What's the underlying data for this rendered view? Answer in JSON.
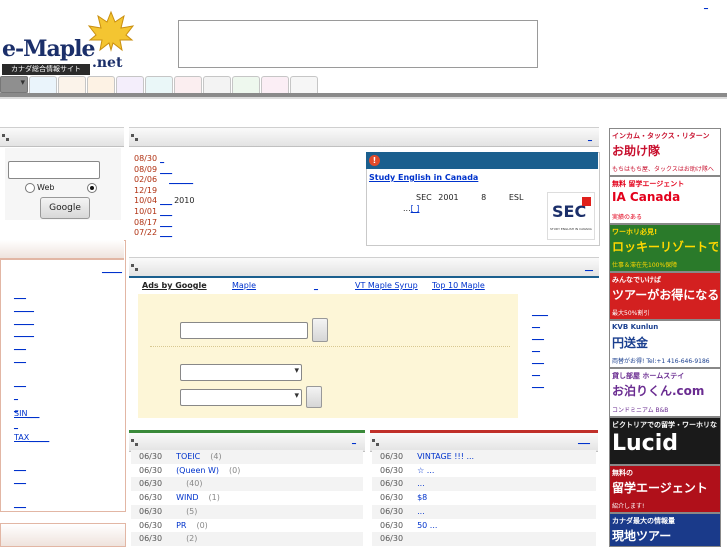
{
  "header": {
    "logo_text": "e-Maple",
    "logo_domain": ".net",
    "logo_tagline": "カナダ総合情報サイト",
    "top_link": "_"
  },
  "tabs": [
    {
      "selected": true,
      "color": "#8f8f8f"
    },
    {
      "color": "#eef1fb"
    },
    {
      "color": "#eaf4fb"
    },
    {
      "color": "#fbf3ea"
    },
    {
      "color": "#fdf2e4"
    },
    {
      "color": "#f4eefb"
    },
    {
      "color": "#eaf7f8"
    },
    {
      "color": "#fbeef0"
    },
    {
      "color": "#f3f3f3"
    },
    {
      "color": "#eef8ee"
    },
    {
      "color": "#fbeef5"
    },
    {
      "color": "#f6f6f6"
    }
  ],
  "search": {
    "web_label": "Web",
    "button_label": "Google",
    "input_value": ""
  },
  "left_panel": {
    "header_link": "_____",
    "items": [
      "___",
      "_____",
      "_____",
      "_____",
      "___",
      "___",
      "___",
      "_",
      "_",
      "SIN___",
      "_",
      "TAX_____",
      "___",
      "___",
      "___"
    ]
  },
  "news": {
    "more_link": "_",
    "items": [
      {
        "date": "08/30",
        "link": "_",
        "tail": ""
      },
      {
        "date": "08/09",
        "link": "___",
        "tail": ""
      },
      {
        "date": "02/06",
        "link": "______",
        "tail": ""
      },
      {
        "date": "12/19",
        "link": "",
        "tail": ""
      },
      {
        "date": "10/04",
        "link": "___",
        "tail": "2010"
      },
      {
        "date": "10/01",
        "link": "___",
        "tail": ""
      },
      {
        "date": "08/17",
        "link": "___",
        "tail": ""
      },
      {
        "date": "07/22",
        "link": "___",
        "tail": ""
      }
    ],
    "feature": {
      "title": "Study English in Canada",
      "line1": [
        "SEC",
        "2001",
        "8",
        "ESL"
      ],
      "line2_prefix": "...",
      "line2_link": "[ ]",
      "logo_text": "SEC",
      "logo_sub": "STUDY ENGLISH IN CANADA"
    }
  },
  "ads": {
    "header_link": "__",
    "ads_by": "Ads by Google",
    "links": [
      "Maple",
      "_",
      "VT Maple Syrup",
      "Top 10 Maple"
    ],
    "side_links": [
      "____",
      "__",
      "___",
      "__",
      "___",
      "__",
      "___"
    ]
  },
  "list_left": {
    "header_link": "_",
    "rows": [
      {
        "date": "06/30",
        "text": "TOEIC",
        "count": "(4)"
      },
      {
        "date": "06/30",
        "text": "(Queen W)",
        "count": "(0)"
      },
      {
        "date": "06/30",
        "text": "",
        "count": "(40)"
      },
      {
        "date": "06/30",
        "text": "WIND",
        "count": "(1)"
      },
      {
        "date": "06/30",
        "text": "",
        "count": "(5)"
      },
      {
        "date": "06/30",
        "text": "PR",
        "count": "(0)"
      },
      {
        "date": "06/30",
        "text": "",
        "count": "(2)"
      }
    ]
  },
  "list_right": {
    "header_link": "___",
    "rows": [
      {
        "date": "06/30",
        "text": "VINTAGE !!! ..."
      },
      {
        "date": "06/30",
        "text": "☆ ..."
      },
      {
        "date": "06/30",
        "text": "..."
      },
      {
        "date": "06/30",
        "text": "$8"
      },
      {
        "date": "06/30",
        "text": "..."
      },
      {
        "date": "06/30",
        "text": "50 ..."
      },
      {
        "date": "06/30",
        "text": ""
      }
    ]
  },
  "banners": [
    {
      "line1": "インカム・タックス・リターン",
      "line2": "お助け隊",
      "line3": "もちはもち屋、タックスはお助け隊へ",
      "bg": "#ffffff",
      "accent": "#c8102e"
    },
    {
      "line1": "無料 留学エージェント",
      "line2": "IA Canada",
      "line3": "実績のある",
      "bg": "#ffffff",
      "accent": "#e3001b"
    },
    {
      "line1": "ワーホリ必見!",
      "line2": "ロッキーリゾートで住み込みで働くプログラム",
      "line3": "仕事＆滞在先100%保障",
      "bg": "#2a7a2a",
      "accent": "#ffd800"
    },
    {
      "line1": "みんなでいけば",
      "line2": "ツアーがお得になる",
      "line3": "最大50%割引",
      "bg": "#d32020",
      "accent": "#ffffff"
    },
    {
      "line1": "KVB Kunlun",
      "line2": "円送金",
      "line3": "両替がお得! Tel:+1 416-646-9186",
      "bg": "#ffffff",
      "accent": "#1a3f8f"
    },
    {
      "line1": "貸し部屋 ホームステイ",
      "line2": "お泊りくん.com",
      "line3": "コンドミニアム B&B",
      "bg": "#ffffff",
      "accent": "#6a2c91"
    },
    {
      "line1": "ビクトリアでの留学・ワーホリなら",
      "line2": "Lucid",
      "line3": "",
      "bg": "#1a1a1a",
      "accent": "#ffffff"
    },
    {
      "line1": "無料の",
      "line2": "留学エージェント",
      "line3": "紹介します!",
      "bg": "#b0101a",
      "accent": "#ffffff"
    },
    {
      "line1": "カナダ最大の情報量",
      "line2": "現地ツアー",
      "line3": "",
      "bg": "#1a3a8a",
      "accent": "#ffffff"
    }
  ]
}
